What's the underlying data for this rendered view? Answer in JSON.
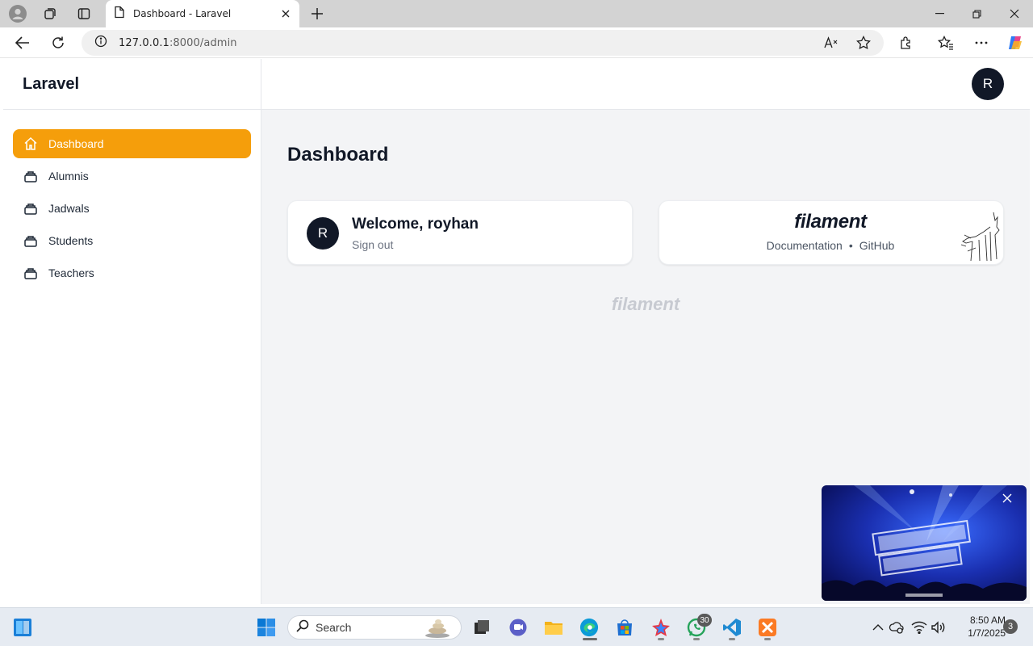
{
  "browser": {
    "tab_title": "Dashboard - Laravel",
    "url_host": "127.0.0.1",
    "url_path": ":8000/admin"
  },
  "app": {
    "brand": "Laravel",
    "user_initial": "R",
    "nav": [
      {
        "label": "Dashboard",
        "active": true
      },
      {
        "label": "Alumnis",
        "active": false
      },
      {
        "label": "Jadwals",
        "active": false
      },
      {
        "label": "Students",
        "active": false
      },
      {
        "label": "Teachers",
        "active": false
      }
    ],
    "page_title": "Dashboard",
    "welcome": {
      "greeting": "Welcome, royhan",
      "signout": "Sign out"
    },
    "filament": {
      "logo": "filament",
      "link_docs": "Documentation",
      "separator": "•",
      "link_github": "GitHub",
      "footer_logo": "filament"
    },
    "accent_color": "#f59e0b"
  },
  "taskbar": {
    "search_placeholder": "Search",
    "whatsapp_badge": "30",
    "time": "8:50 AM",
    "date": "1/7/2025",
    "notifications": "3"
  }
}
